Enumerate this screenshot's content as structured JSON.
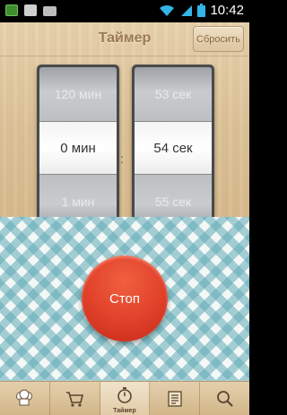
{
  "status_bar": {
    "time": "10:42",
    "icons": [
      "app-icon",
      "image-icon",
      "camera-icon",
      "wifi-icon",
      "signal-icon",
      "battery-icon"
    ]
  },
  "header": {
    "title": "Таймер",
    "reset_label": "Сбросить"
  },
  "picker_minutes": {
    "above": "120 мин",
    "selected": "0 мин",
    "below": "1 мин"
  },
  "picker_seconds": {
    "above": "53 сек",
    "selected": "54 сек",
    "below": "55 сек"
  },
  "separator": ":",
  "stop_label": "Стоп",
  "tabs": [
    {
      "icon": "chef-hat-icon",
      "label": ""
    },
    {
      "icon": "cart-icon",
      "label": ""
    },
    {
      "icon": "stopwatch-icon",
      "label": "Таймер",
      "active": true
    },
    {
      "icon": "list-icon",
      "label": ""
    },
    {
      "icon": "search-icon",
      "label": ""
    }
  ],
  "colors": {
    "stop_button": "#e0402a",
    "wood": "#dcc299",
    "cloth_check": "#60aab6"
  }
}
